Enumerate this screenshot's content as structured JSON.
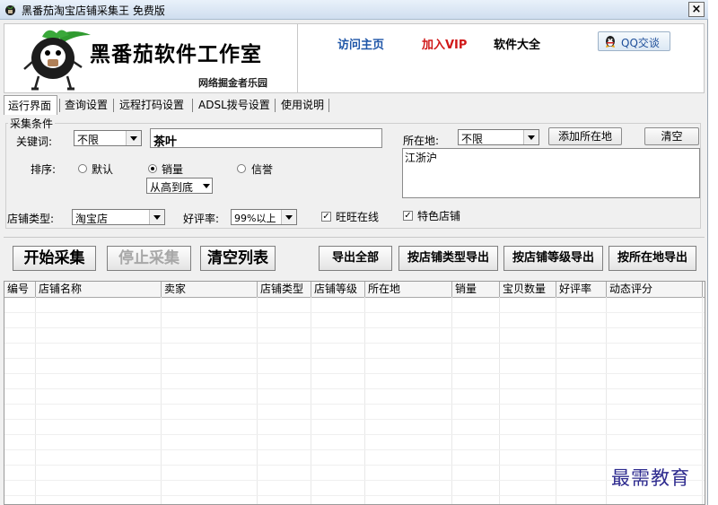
{
  "window": {
    "title": "黑番茄淘宝店铺采集王   免费版",
    "close_symbol": "×"
  },
  "banner": {
    "logo_title": "黑番茄软件工作室",
    "logo_subtitle": "网络掘金者乐园",
    "links": [
      "访问主页",
      "加入VIP",
      "软件大全"
    ],
    "qq_button": "QQ交谈"
  },
  "tabs": [
    "运行界面",
    "查询设置",
    "远程打码设置",
    "ADSL拨号设置",
    "使用说明"
  ],
  "form": {
    "group_title": "采集条件",
    "keyword_label": "关键词:",
    "keyword_scope": "不限",
    "keyword_value": "茶叶",
    "location_label": "所在地:",
    "location_value": "不限",
    "add_location_button": "添加所在地",
    "clear_button": "清空",
    "location_list": "江浙沪",
    "sort_label": "排序:",
    "sort_options": [
      "默认",
      "销量",
      "信誉"
    ],
    "sort_selected": "销量",
    "sort_order": "从高到底",
    "shop_type_label": "店铺类型:",
    "shop_type_value": "淘宝店",
    "rating_label": "好评率:",
    "rating_value": "99%以上",
    "wangwang_label": "旺旺在线",
    "wangwang_checked": true,
    "featured_label": "特色店铺",
    "featured_checked": true
  },
  "actions": {
    "start": "开始采集",
    "stop": "停止采集",
    "clear_list": "清空列表",
    "export_all": "导出全部",
    "export_by_type": "按店铺类型导出",
    "export_by_level": "按店铺等级导出",
    "export_by_location": "按所在地导出"
  },
  "table": {
    "columns": [
      "编号",
      "店铺名称",
      "卖家",
      "店铺类型",
      "店铺等级",
      "所在地",
      "销量",
      "宝贝数量",
      "好评率",
      "动态评分"
    ],
    "rows": []
  },
  "watermark": "最需教育"
}
